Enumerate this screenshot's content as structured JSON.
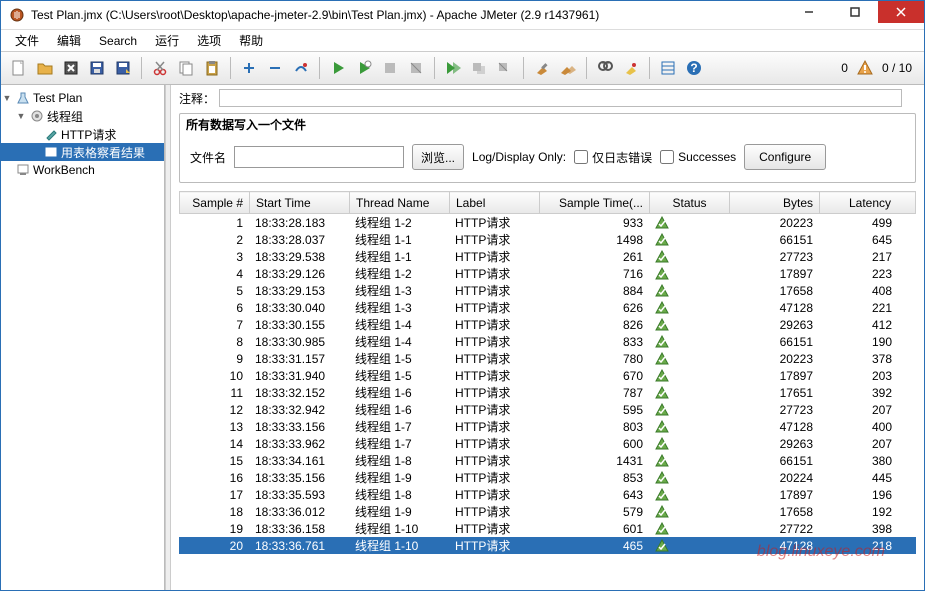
{
  "window": {
    "title": "Test Plan.jmx (C:\\Users\\root\\Desktop\\apache-jmeter-2.9\\bin\\Test Plan.jmx) - Apache JMeter (2.9 r1437961)"
  },
  "menu": {
    "file": "文件",
    "edit": "编辑",
    "search": "Search",
    "run": "运行",
    "options": "选项",
    "help": "帮助"
  },
  "toolbar": {
    "count_current": "0",
    "counter": "0 / 10"
  },
  "tree": {
    "test_plan": "Test Plan",
    "thread_group": "线程组",
    "http_request": "HTTP请求",
    "view_results": "用表格察看结果",
    "workbench": "WorkBench"
  },
  "comment": {
    "label": "注释：",
    "value": ""
  },
  "filepanel": {
    "title": "所有数据写入一个文件",
    "filename_label": "文件名",
    "filename_value": "",
    "browse": "浏览...",
    "logdisplay": "Log/Display Only:",
    "errors_only": "仅日志错误",
    "successes": "Successes",
    "configure": "Configure"
  },
  "table": {
    "headers": {
      "sample": "Sample #",
      "start": "Start Time",
      "thread": "Thread Name",
      "label": "Label",
      "stime": "Sample Time(...",
      "status": "Status",
      "bytes": "Bytes",
      "latency": "Latency"
    },
    "rows": [
      {
        "n": "1",
        "t": "18:33:28.183",
        "th": "线程组 1-2",
        "l": "HTTP请求",
        "st": "933",
        "b": "20223",
        "la": "499"
      },
      {
        "n": "2",
        "t": "18:33:28.037",
        "th": "线程组 1-1",
        "l": "HTTP请求",
        "st": "1498",
        "b": "66151",
        "la": "645"
      },
      {
        "n": "3",
        "t": "18:33:29.538",
        "th": "线程组 1-1",
        "l": "HTTP请求",
        "st": "261",
        "b": "27723",
        "la": "217"
      },
      {
        "n": "4",
        "t": "18:33:29.126",
        "th": "线程组 1-2",
        "l": "HTTP请求",
        "st": "716",
        "b": "17897",
        "la": "223"
      },
      {
        "n": "5",
        "t": "18:33:29.153",
        "th": "线程组 1-3",
        "l": "HTTP请求",
        "st": "884",
        "b": "17658",
        "la": "408"
      },
      {
        "n": "6",
        "t": "18:33:30.040",
        "th": "线程组 1-3",
        "l": "HTTP请求",
        "st": "626",
        "b": "47128",
        "la": "221"
      },
      {
        "n": "7",
        "t": "18:33:30.155",
        "th": "线程组 1-4",
        "l": "HTTP请求",
        "st": "826",
        "b": "29263",
        "la": "412"
      },
      {
        "n": "8",
        "t": "18:33:30.985",
        "th": "线程组 1-4",
        "l": "HTTP请求",
        "st": "833",
        "b": "66151",
        "la": "190"
      },
      {
        "n": "9",
        "t": "18:33:31.157",
        "th": "线程组 1-5",
        "l": "HTTP请求",
        "st": "780",
        "b": "20223",
        "la": "378"
      },
      {
        "n": "10",
        "t": "18:33:31.940",
        "th": "线程组 1-5",
        "l": "HTTP请求",
        "st": "670",
        "b": "17897",
        "la": "203"
      },
      {
        "n": "11",
        "t": "18:33:32.152",
        "th": "线程组 1-6",
        "l": "HTTP请求",
        "st": "787",
        "b": "17651",
        "la": "392"
      },
      {
        "n": "12",
        "t": "18:33:32.942",
        "th": "线程组 1-6",
        "l": "HTTP请求",
        "st": "595",
        "b": "27723",
        "la": "207"
      },
      {
        "n": "13",
        "t": "18:33:33.156",
        "th": "线程组 1-7",
        "l": "HTTP请求",
        "st": "803",
        "b": "47128",
        "la": "400"
      },
      {
        "n": "14",
        "t": "18:33:33.962",
        "th": "线程组 1-7",
        "l": "HTTP请求",
        "st": "600",
        "b": "29263",
        "la": "207"
      },
      {
        "n": "15",
        "t": "18:33:34.161",
        "th": "线程组 1-8",
        "l": "HTTP请求",
        "st": "1431",
        "b": "66151",
        "la": "380"
      },
      {
        "n": "16",
        "t": "18:33:35.156",
        "th": "线程组 1-9",
        "l": "HTTP请求",
        "st": "853",
        "b": "20224",
        "la": "445"
      },
      {
        "n": "17",
        "t": "18:33:35.593",
        "th": "线程组 1-8",
        "l": "HTTP请求",
        "st": "643",
        "b": "17897",
        "la": "196"
      },
      {
        "n": "18",
        "t": "18:33:36.012",
        "th": "线程组 1-9",
        "l": "HTTP请求",
        "st": "579",
        "b": "17658",
        "la": "192"
      },
      {
        "n": "19",
        "t": "18:33:36.158",
        "th": "线程组 1-10",
        "l": "HTTP请求",
        "st": "601",
        "b": "27722",
        "la": "398"
      },
      {
        "n": "20",
        "t": "18:33:36.761",
        "th": "线程组 1-10",
        "l": "HTTP请求",
        "st": "465",
        "b": "47128",
        "la": "218"
      }
    ],
    "selected_index": 19
  },
  "watermark": "blog.linuxeye.com"
}
